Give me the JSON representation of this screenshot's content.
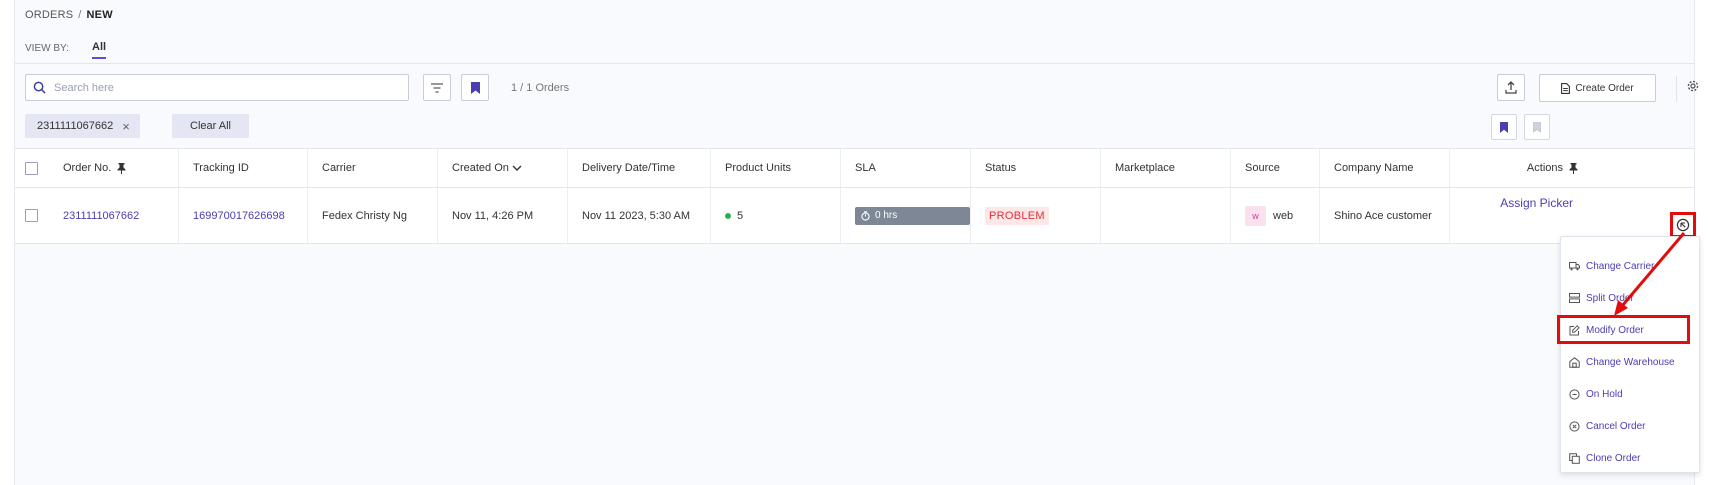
{
  "breadcrumb": {
    "parent": "ORDERS",
    "separator": "/",
    "current": "NEW"
  },
  "viewby": {
    "label": "VIEW BY:",
    "active_tab": "All"
  },
  "toolbar": {
    "search_placeholder": "Search here",
    "orders_count": "1 / 1 Orders",
    "create_label": "Create Order"
  },
  "filters": {
    "chip_value": "2311111067662",
    "clear_label": "Clear All"
  },
  "table": {
    "headers": {
      "order_no": "Order No.",
      "tracking_id": "Tracking ID",
      "carrier": "Carrier",
      "created_on": "Created On",
      "delivery": "Delivery Date/Time",
      "units": "Product Units",
      "sla": "SLA",
      "status": "Status",
      "marketplace": "Marketplace",
      "source": "Source",
      "company": "Company Name",
      "actions": "Actions"
    },
    "row": {
      "order_no": "2311111067662",
      "tracking_id": "169970017626698",
      "carrier": "Fedex Christy Ng",
      "created_on": "Nov 11, 4:26 PM",
      "delivery": "Nov 11 2023, 5:30 AM",
      "units": "5",
      "sla": "0 hrs",
      "status": "PROBLEM",
      "marketplace": "",
      "source_badge": "w",
      "source": "web",
      "company": "Shino Ace customer",
      "action_label": "Assign Picker"
    }
  },
  "menu": {
    "items": [
      {
        "label": "Change Carrier",
        "icon": "truck-icon"
      },
      {
        "label": "Split Order",
        "icon": "split-icon"
      },
      {
        "label": "Modify Order",
        "icon": "edit-icon"
      },
      {
        "label": "Change Warehouse",
        "icon": "warehouse-icon"
      },
      {
        "label": "On Hold",
        "icon": "pause-circle-icon"
      },
      {
        "label": "Cancel Order",
        "icon": "cancel-circle-icon"
      },
      {
        "label": "Clone Order",
        "icon": "copy-icon"
      }
    ]
  },
  "colors": {
    "accent": "#4a3fb0",
    "annotation": "#e10c0c",
    "status_problem": "#e0303c",
    "sla_badge": "#7d8796"
  }
}
